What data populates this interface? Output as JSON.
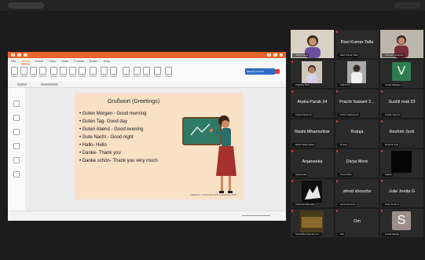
{
  "presentation": {
    "menu": [
      "File",
      "Home",
      "Insert",
      "View",
      "Tools",
      "Format",
      "Share",
      "Help"
    ],
    "meeting_badge": "Meeting controls",
    "slide": {
      "title": "Grußwort (Greetings)",
      "lines": [
        "• Guten Morgen - Good morning",
        "• Guten Tag- Good day",
        "• Guten Abend - Good evening",
        "• Gute Nacht - Good night",
        "• Hallo- Hello",
        "• Danke- Thank you",
        "• Danke schön- Thank you very much"
      ],
      "footer": "GERMAN LANGUAGE FOR LANGUAGE HUB"
    }
  },
  "participants": [
    {
      "name": "",
      "label": "Shikha Negi",
      "kind": "video",
      "highlight": true
    },
    {
      "name": "Ravi Kumar Talla",
      "label": "Ravi Kumar Talla",
      "kind": "name"
    },
    {
      "name": "",
      "label": "Poonam Gaikwad",
      "kind": "video"
    },
    {
      "name": "",
      "label": "Prajakta Bhor",
      "kind": "video"
    },
    {
      "name": "",
      "label": "Nikhil Pal",
      "kind": "video"
    },
    {
      "name": "",
      "label": "Vishal Mahajan",
      "kind": "letter",
      "letter": "V",
      "color": "#2e7d4f"
    },
    {
      "name": "Arpita Parab 24",
      "label": "Arpita Parab 24",
      "kind": "name"
    },
    {
      "name": "Prachi Sawant 2...",
      "label": "Prachi Sawant 27",
      "kind": "name"
    },
    {
      "name": "Sushil mali 23",
      "label": "Sushil mali 23",
      "kind": "name"
    },
    {
      "name": "Rashi Mhamunkar",
      "label": "Rashi Mhamunkar",
      "kind": "name"
    },
    {
      "name": "Rutuja",
      "label": "Rutuja",
      "kind": "name"
    },
    {
      "name": "Reshmi Jyoti",
      "label": "Reshmi Jyoti",
      "kind": "name"
    },
    {
      "name": "Anjaneeka",
      "label": "Anjaneeka",
      "kind": "name"
    },
    {
      "name": "Divya More",
      "label": "Divya More",
      "kind": "name"
    },
    {
      "name": "",
      "label": "Sakshi",
      "kind": "dark"
    },
    {
      "name": "",
      "label": "Vaishnavi Bhosale",
      "kind": "video"
    },
    {
      "name": "shruti shouche",
      "label": "shruti shouche",
      "kind": "name"
    },
    {
      "name": "Julie Jenita G",
      "label": "Julie Jenita G",
      "kind": "name"
    },
    {
      "name": "",
      "label": "Shraddha Sonekar Su...",
      "kind": "video"
    },
    {
      "name": "Om",
      "label": "Om",
      "kind": "name"
    },
    {
      "name": "",
      "label": "Sushil Shinde",
      "kind": "letter",
      "letter": "S",
      "color": "#9e8e8b"
    }
  ]
}
